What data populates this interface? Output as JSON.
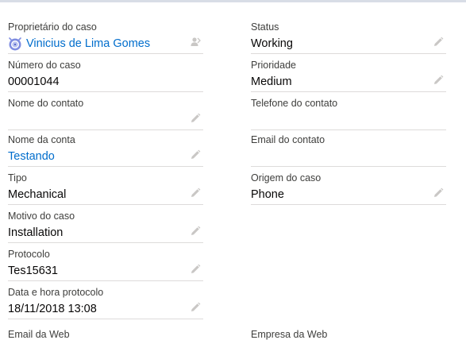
{
  "left_fields": [
    {
      "label": "Proprietário do caso",
      "value": "Vinicius de Lima Gomes",
      "link": true,
      "icon": "change-owner-icon"
    },
    {
      "label": "Número do caso",
      "value": "00001044",
      "link": false,
      "icon": ""
    },
    {
      "label": "Nome do contato",
      "value": "",
      "link": false,
      "icon": "pencil-icon"
    },
    {
      "label": "Nome da conta",
      "value": "Testando",
      "link": true,
      "icon": "pencil-icon"
    },
    {
      "label": "Tipo",
      "value": "Mechanical",
      "link": false,
      "icon": "pencil-icon"
    },
    {
      "label": "Motivo do caso",
      "value": "Installation",
      "link": false,
      "icon": "pencil-icon"
    },
    {
      "label": "Protocolo",
      "value": "Tes15631",
      "link": false,
      "icon": "pencil-icon"
    },
    {
      "label": "Data e hora protocolo",
      "value": "18/11/2018 13:08",
      "link": false,
      "icon": "pencil-icon"
    }
  ],
  "right_fields": [
    {
      "label": "Status",
      "value": "Working",
      "link": false,
      "icon": "pencil-icon"
    },
    {
      "label": "Prioridade",
      "value": "Medium",
      "link": false,
      "icon": "pencil-icon"
    },
    {
      "label": "Telefone do contato",
      "value": "",
      "link": false,
      "icon": ""
    },
    {
      "label": "Email do contato",
      "value": "",
      "link": false,
      "icon": ""
    },
    {
      "label": "Origem do caso",
      "value": "Phone",
      "link": false,
      "icon": "pencil-icon"
    }
  ],
  "partial_labels": {
    "left": "Email da Web",
    "right": "Empresa da Web"
  },
  "colors": {
    "link": "#006dcc",
    "label": "#3e3e3c",
    "divider": "#dddbda",
    "icon": "#c9c7c5"
  }
}
